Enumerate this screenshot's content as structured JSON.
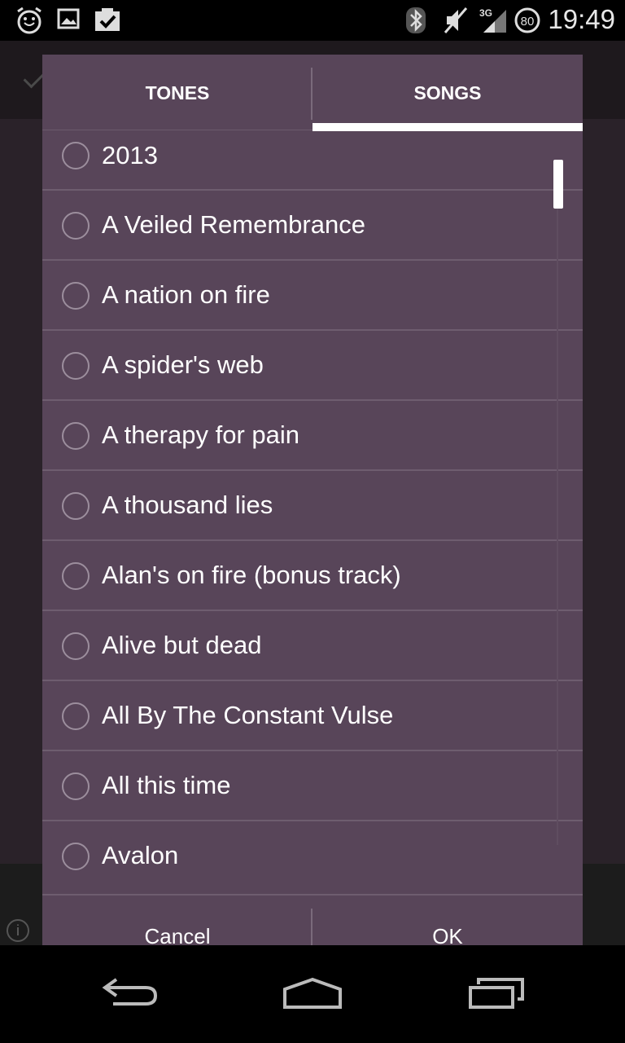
{
  "status_bar": {
    "time": "19:49",
    "network": "3G",
    "battery_level": "80",
    "icons": [
      "alarm-icon",
      "image-icon",
      "checklist-icon",
      "bluetooth-icon",
      "mute-icon",
      "signal-icon",
      "battery-icon"
    ]
  },
  "dialog": {
    "tabs": [
      {
        "label": "TONES",
        "selected": false
      },
      {
        "label": "SONGS",
        "selected": true
      }
    ],
    "songs": [
      "2013",
      "A Veiled Remembrance",
      "A nation on fire",
      "A spider's web",
      "A therapy for pain",
      "A thousand lies",
      "Alan's on fire (bonus track)",
      "Alive but dead",
      "All By The Constant Vulse",
      "All this time",
      "Avalon"
    ],
    "cancel_label": "Cancel",
    "ok_label": "OK"
  },
  "background": {
    "info_label": "i"
  },
  "colors": {
    "dialog_bg": "#584559",
    "divider": "#6e5d6f",
    "indicator": "#ffffff"
  }
}
